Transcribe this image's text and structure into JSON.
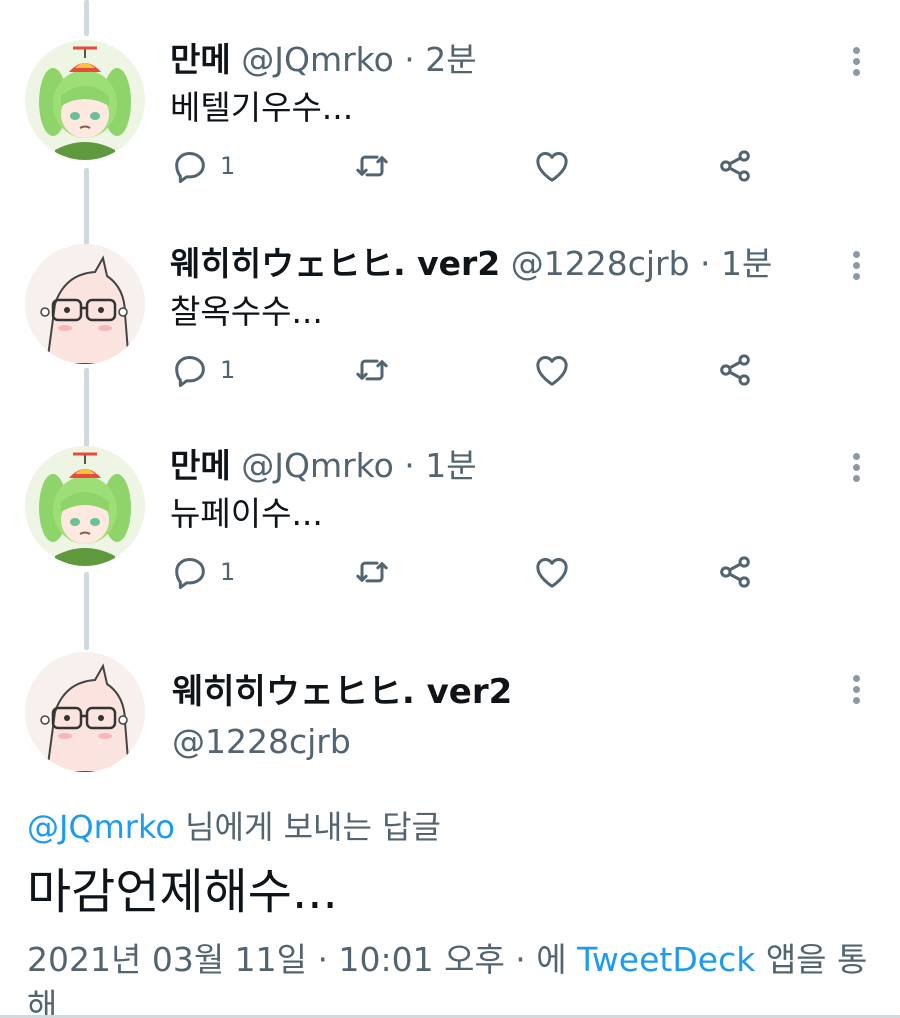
{
  "tweets": [
    {
      "name": "만메",
      "handle": "@JQmrko",
      "sep": "·",
      "time": "2분",
      "text": "베텔기우수...",
      "reply_count": "1",
      "avatar": "green-hair-character-avatar"
    },
    {
      "name": "웨히히ウェヒヒ. ver2",
      "handle": "@1228cjrb",
      "sep": "·",
      "time": "1분",
      "text": "찰옥수수...",
      "reply_count": "1",
      "avatar": "glasses-character-avatar"
    },
    {
      "name": "만메",
      "handle": "@JQmrko",
      "sep": "·",
      "time": "1분",
      "text": "뉴페이수...",
      "reply_count": "1",
      "avatar": "green-hair-character-avatar"
    }
  ],
  "main": {
    "name": "웨히히ウェヒヒ. ver2",
    "handle": "@1228cjrb",
    "reply_mention": "@JQmrko",
    "reply_suffix": " 님에게 보내는 답글",
    "text": "마감언제해수...",
    "meta_date": "2021년 03월 11일 · 10:01 오후 · 에 ",
    "meta_source": "TweetDeck",
    "meta_suffix": " 앱을 통해",
    "avatar": "glasses-character-avatar"
  },
  "icons": {
    "reply": "reply-icon",
    "retweet": "retweet-icon",
    "like": "heart-icon",
    "share": "share-icon",
    "more": "more-vertical-icon"
  },
  "colors": {
    "link": "#1d9bf0",
    "secondary_text": "#536471",
    "thread_line": "#cfd9de"
  }
}
